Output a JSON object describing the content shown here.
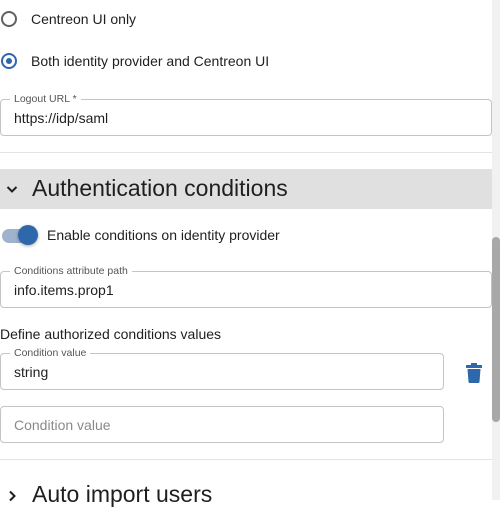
{
  "redirect_options": [
    {
      "label": "Centreon UI only",
      "checked": false
    },
    {
      "label": "Both identity provider and Centreon UI",
      "checked": true
    }
  ],
  "logout_url": {
    "label": "Logout URL *",
    "value": "https://idp/saml"
  },
  "auth_conditions": {
    "title": "Authentication conditions",
    "toggle_label": "Enable conditions on identity provider",
    "toggle_on": true,
    "attribute_path": {
      "label": "Conditions attribute path",
      "value": "info.items.prop1"
    },
    "define_label": "Define authorized conditions values",
    "conditions": [
      {
        "label": "Condition value",
        "value": "string"
      }
    ],
    "new_condition_placeholder": "Condition value"
  },
  "auto_import": {
    "title": "Auto import users"
  },
  "colors": {
    "accent": "#2e68aa",
    "section_bg": "#e0e0e0",
    "border": "#c4c4c4"
  },
  "icons": {
    "delete": "trash-icon",
    "expanded": "chevron-down-icon",
    "collapsed": "chevron-right-icon"
  }
}
